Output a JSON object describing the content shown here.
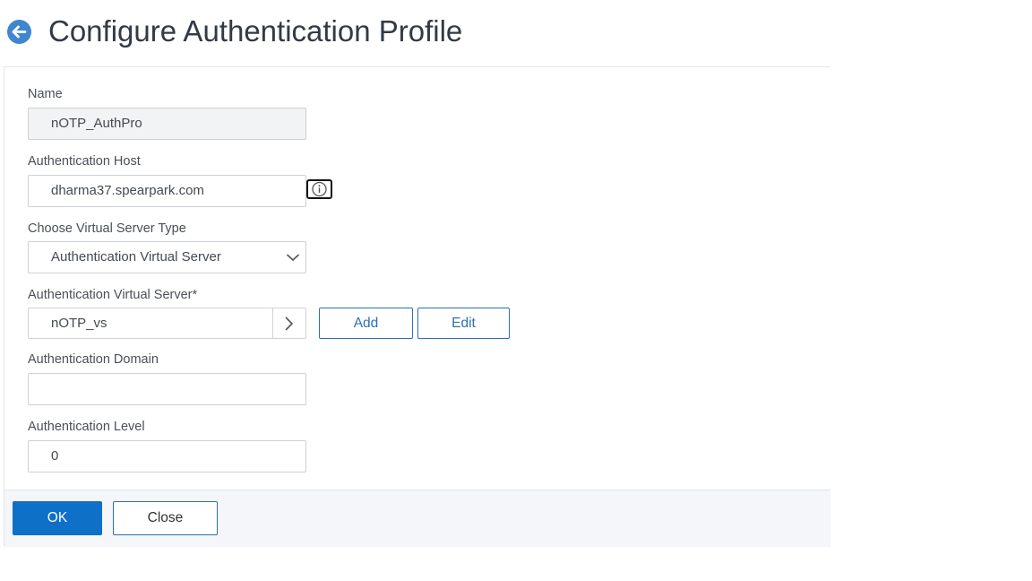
{
  "header": {
    "title": "Configure Authentication Profile",
    "back_icon": "back-arrow-icon",
    "accent_color": "#3f86d0"
  },
  "form": {
    "name": {
      "label": "Name",
      "value": "nOTP_AuthPro"
    },
    "auth_host": {
      "label": "Authentication Host",
      "value": "dharma37.spearpark.com",
      "info_icon": "info-icon"
    },
    "vs_type": {
      "label": "Choose Virtual Server Type",
      "selected": "Authentication Virtual Server"
    },
    "auth_vs": {
      "label": "Authentication Virtual Server*",
      "value": "nOTP_vs",
      "add_label": "Add",
      "edit_label": "Edit"
    },
    "auth_domain": {
      "label": "Authentication Domain",
      "value": ""
    },
    "auth_level": {
      "label": "Authentication Level",
      "value": "0"
    }
  },
  "footer": {
    "ok_label": "OK",
    "close_label": "Close",
    "primary_color": "#0f70c7"
  }
}
